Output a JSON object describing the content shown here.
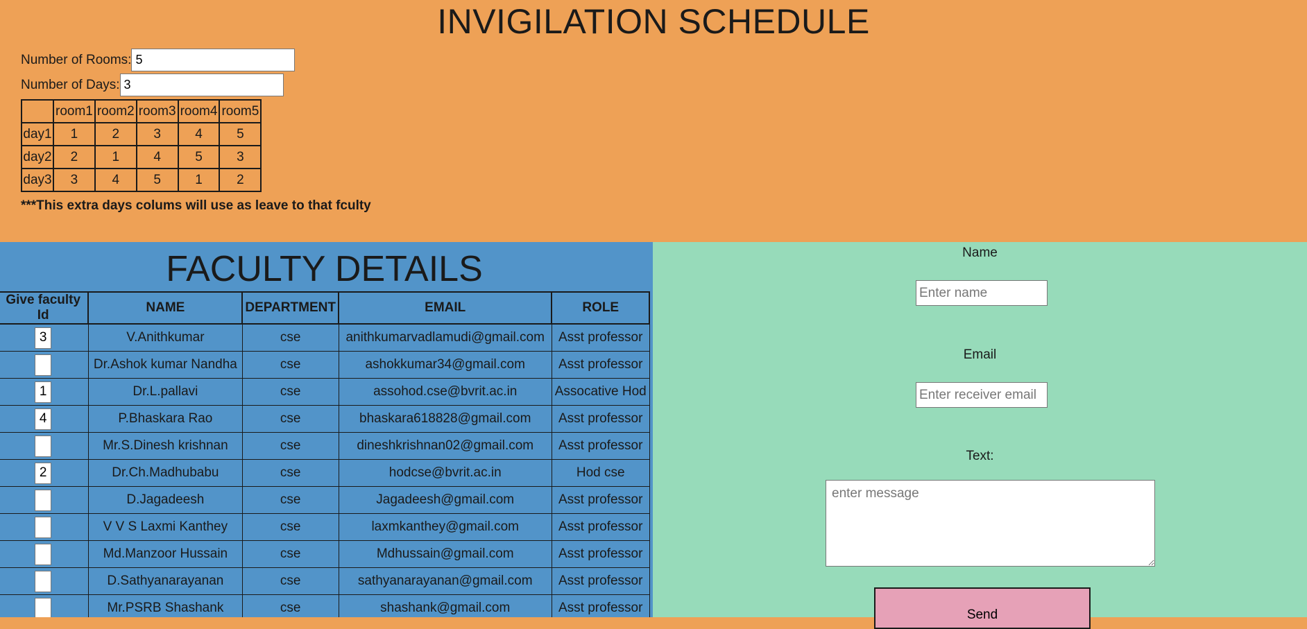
{
  "header": {
    "title": "INVIGILATION SCHEDULE"
  },
  "config": {
    "rooms_label": "Number of Rooms:",
    "rooms_value": "5",
    "days_label": "Number of Days:",
    "days_value": "3"
  },
  "schedule": {
    "corner": "",
    "columns": [
      "room1",
      "room2",
      "room3",
      "room4",
      "room5"
    ],
    "rows": [
      {
        "label": "day1",
        "cells": [
          "1",
          "2",
          "3",
          "4",
          "5"
        ]
      },
      {
        "label": "day2",
        "cells": [
          "2",
          "1",
          "4",
          "5",
          "3"
        ]
      },
      {
        "label": "day3",
        "cells": [
          "3",
          "4",
          "5",
          "1",
          "2"
        ]
      }
    ],
    "note": "***This extra days colums will use as leave to that fculty"
  },
  "faculty": {
    "title": "FACULTY DETAILS",
    "headers": [
      "Give faculty Id",
      "NAME",
      "DEPARTMENT",
      "EMAIL",
      "ROLE"
    ],
    "rows": [
      {
        "id": "3",
        "name": "V.Anithkumar",
        "department": "cse",
        "email": "anithkumarvadlamudi@gmail.com",
        "role": "Asst professor"
      },
      {
        "id": "",
        "name": "Dr.Ashok kumar Nandha",
        "department": "cse",
        "email": "ashokkumar34@gmail.com",
        "role": "Asst professor"
      },
      {
        "id": "1",
        "name": "Dr.L.pallavi",
        "department": "cse",
        "email": "assohod.cse@bvrit.ac.in",
        "role": "Assocative Hod"
      },
      {
        "id": "4",
        "name": "P.Bhaskara Rao",
        "department": "cse",
        "email": "bhaskara618828@gmail.com",
        "role": "Asst professor"
      },
      {
        "id": "",
        "name": "Mr.S.Dinesh krishnan",
        "department": "cse",
        "email": "dineshkrishnan02@gmail.com",
        "role": "Asst professor"
      },
      {
        "id": "2",
        "name": "Dr.Ch.Madhubabu",
        "department": "cse",
        "email": "hodcse@bvrit.ac.in",
        "role": "Hod cse"
      },
      {
        "id": "",
        "name": "D.Jagadeesh",
        "department": "cse",
        "email": "Jagadeesh@gmail.com",
        "role": "Asst professor"
      },
      {
        "id": "",
        "name": "V V S Laxmi Kanthey",
        "department": "cse",
        "email": "laxmkanthey@gmail.com",
        "role": "Asst professor"
      },
      {
        "id": "",
        "name": "Md.Manzoor Hussain",
        "department": "cse",
        "email": "Mdhussain@gmail.com",
        "role": "Asst professor"
      },
      {
        "id": "",
        "name": "D.Sathyanarayanan",
        "department": "cse",
        "email": "sathyanarayanan@gmail.com",
        "role": "Asst professor"
      },
      {
        "id": "",
        "name": "Mr.PSRB Shashank",
        "department": "cse",
        "email": "shashank@gmail.com",
        "role": "Asst professor"
      }
    ]
  },
  "mail": {
    "name_label": "Name",
    "name_placeholder": "Enter name",
    "email_label": "Email",
    "email_placeholder": "Enter receiver email",
    "text_label": "Text:",
    "text_placeholder": "enter message",
    "send_label": "Send"
  },
  "colors": {
    "header_bg": "#eea156",
    "faculty_bg": "#5294c9",
    "mail_bg": "#97dbba",
    "send_bg": "#e6a1b7"
  }
}
